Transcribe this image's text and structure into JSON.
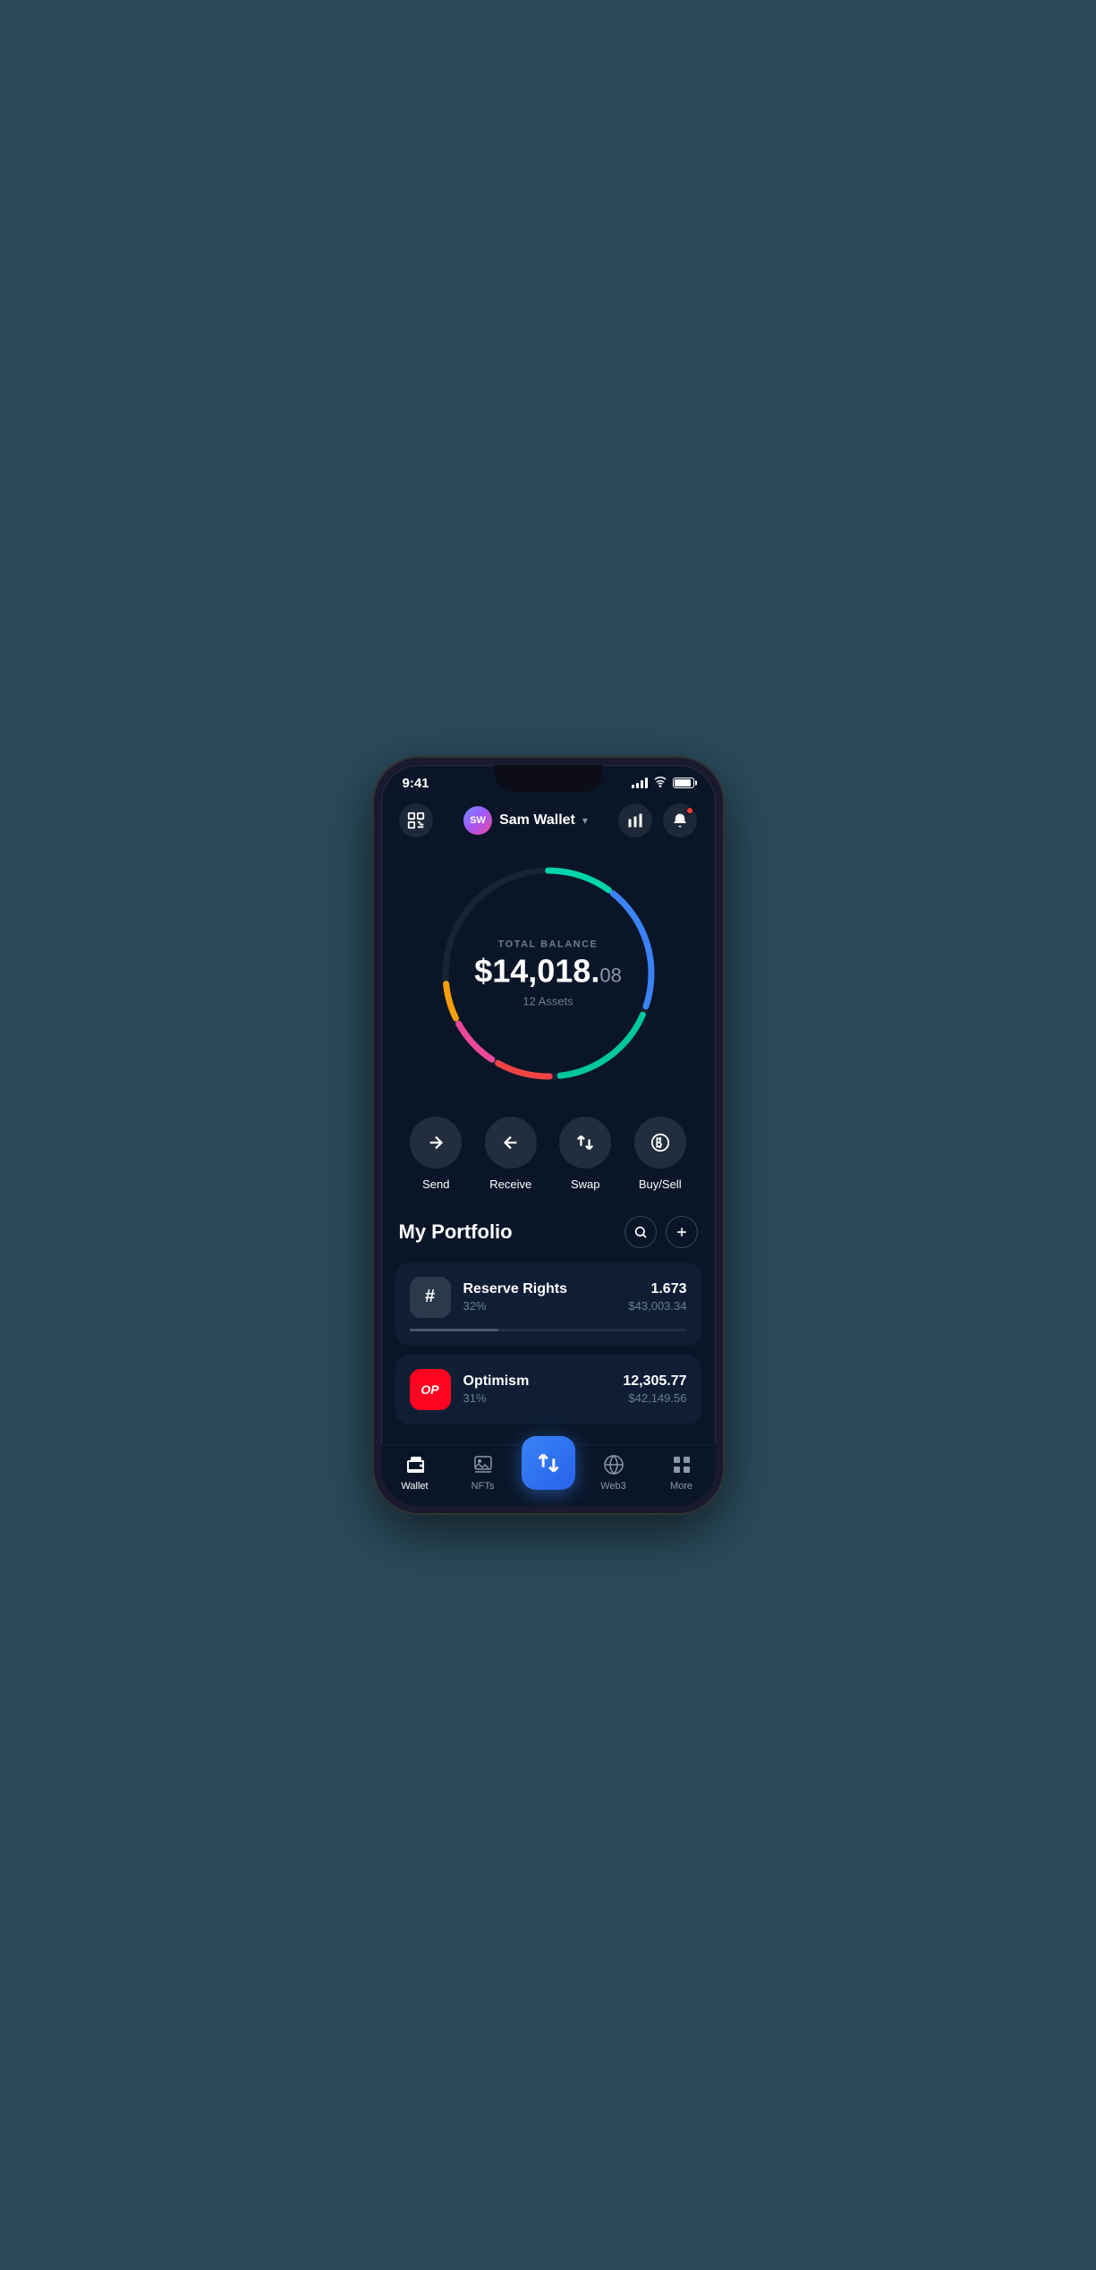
{
  "statusBar": {
    "time": "9:41"
  },
  "header": {
    "accountName": "Sam Wallet",
    "avatarInitials": "SW",
    "scanIconLabel": "scan-icon",
    "statsIconLabel": "stats-icon",
    "bellIconLabel": "bell-icon",
    "chevronLabel": "▾"
  },
  "balance": {
    "label": "TOTAL BALANCE",
    "amountMain": "$14,018.",
    "amountCents": "08",
    "assets": "12 Assets"
  },
  "actions": [
    {
      "id": "send",
      "label": "Send",
      "icon": "→"
    },
    {
      "id": "receive",
      "label": "Receive",
      "icon": "←"
    },
    {
      "id": "swap",
      "label": "Swap",
      "icon": "⇅"
    },
    {
      "id": "buysell",
      "label": "Buy/Sell",
      "icon": "$"
    }
  ],
  "portfolio": {
    "title": "My Portfolio",
    "searchLabel": "🔍",
    "addLabel": "+"
  },
  "assets": [
    {
      "id": "rsr",
      "name": "Reserve Rights",
      "pct": "32%",
      "amount": "1.673",
      "usd": "$43,003.34",
      "barWidth": "32",
      "barColor": "#6b7d8e"
    },
    {
      "id": "op",
      "name": "Optimism",
      "pct": "31%",
      "amount": "12,305.77",
      "usd": "$42,149.56",
      "barWidth": "31",
      "barColor": "#ff0420"
    }
  ],
  "bottomNav": [
    {
      "id": "wallet",
      "label": "Wallet",
      "active": true
    },
    {
      "id": "nfts",
      "label": "NFTs",
      "active": false
    },
    {
      "id": "center",
      "label": "",
      "isCenter": true
    },
    {
      "id": "web3",
      "label": "Web3",
      "active": false
    },
    {
      "id": "more",
      "label": "More",
      "active": false
    }
  ],
  "colors": {
    "background": "#0a1628",
    "cardBg": "#0f1e35",
    "accent": "#3b82f6",
    "textPrimary": "#ffffff",
    "textSecondary": "#6b7d8e"
  }
}
